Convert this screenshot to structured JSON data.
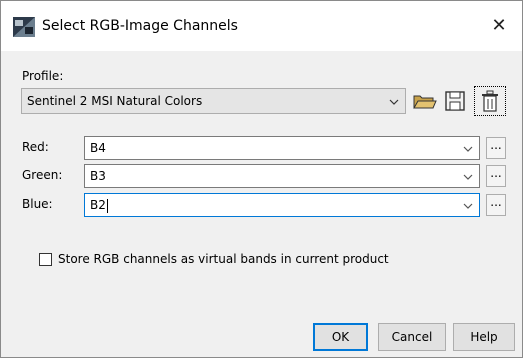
{
  "dialog": {
    "title": "Select RGB-Image Channels",
    "close_glyph": "✕"
  },
  "profile": {
    "label": "Profile:",
    "selected": "Sentinel 2 MSI Natural Colors",
    "icons": [
      "open-folder-icon",
      "save-disk-icon",
      "delete-trash-icon"
    ]
  },
  "channels": [
    {
      "label": "Red:",
      "value": "B4",
      "more": "..."
    },
    {
      "label": "Green:",
      "value": "B3",
      "more": "..."
    },
    {
      "label": "Blue:",
      "value": "B2",
      "more": "..."
    }
  ],
  "store_virtual": {
    "label": "Store RGB channels as virtual bands in current product",
    "checked": false
  },
  "buttons": {
    "ok": "OK",
    "cancel": "Cancel",
    "help": "Help"
  },
  "colors": {
    "dialog_bg": "#f0f0f0",
    "default_button_border": "#0078d7",
    "folder": "#c8a24a"
  }
}
